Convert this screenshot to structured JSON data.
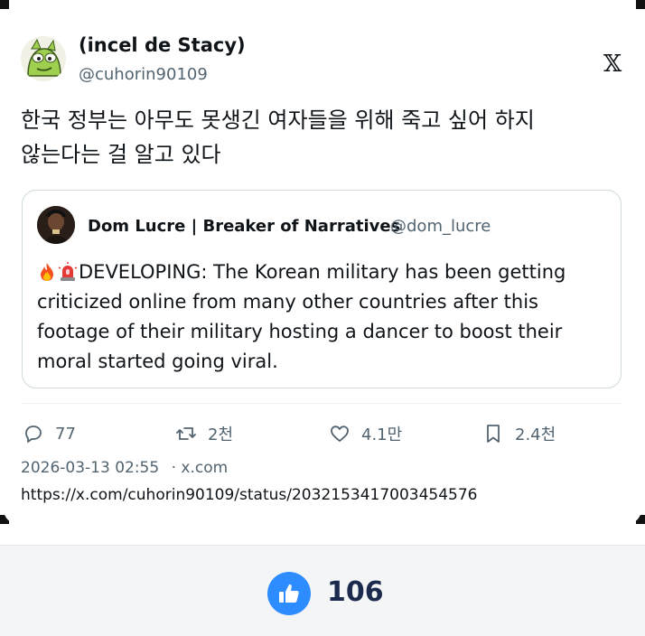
{
  "post": {
    "user_name": "(incel de Stacy)",
    "user_handle": "@cuhorin90109",
    "text_line1": "한국 정부는 아무도 못생긴 여자들을 위해 죽고 싶어 하지",
    "text_line2": "않는다는 걸 알고 있다",
    "quote": {
      "name": "Dom Lucre | Breaker of Narratives",
      "handle": "@dom_lucre",
      "body_line1": "DEVELOPING: The Korean military has been getting",
      "body_line2": "criticized online from many other countries after this",
      "body_line3": "footage of their military hosting a dancer to boost their",
      "body_line4": "moral started going viral."
    },
    "actions": {
      "replies": "77",
      "reposts": "2천",
      "likes": "4.1만",
      "bookmarks": "2.4천"
    },
    "timestamp": "2026-03-13 02:55",
    "source": "· x.com",
    "url": "https://x.com/cuhorin90109/status/2032153417003454576",
    "x_logo": "𝕏"
  },
  "footer": {
    "like_count": "106"
  },
  "colors": {
    "text": "#0f1419",
    "muted": "#536471",
    "like_blue": "#2d8cff"
  },
  "icons": [
    "reply-icon",
    "repost-icon",
    "heart-icon",
    "bookmark-icon",
    "thumbs-up-icon",
    "x-logo-icon",
    "fire-emoji",
    "siren-emoji"
  ]
}
